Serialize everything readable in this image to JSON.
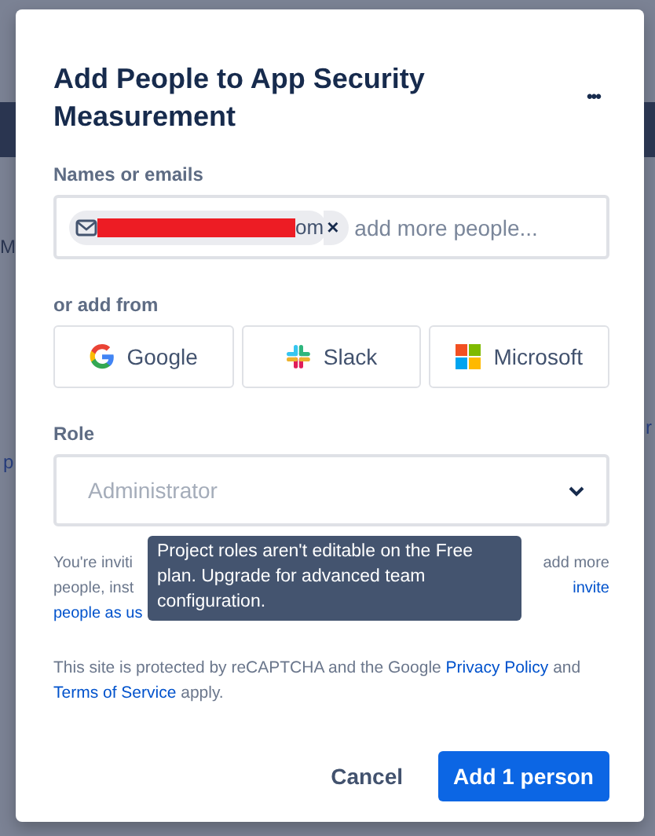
{
  "backdrop_left": [
    "M",
    "p"
  ],
  "backdrop_right": [
    "r"
  ],
  "dialog": {
    "title": "Add People to App Security Measurement",
    "menu": "•••"
  },
  "names": {
    "label": "Names or emails",
    "chip": {
      "visible_text": "om",
      "redacted": true,
      "remove": "×"
    },
    "placeholder": "add more people..."
  },
  "sources": {
    "label": "or add from",
    "buttons": [
      {
        "kind": "google",
        "label": "Google"
      },
      {
        "kind": "slack",
        "label": "Slack"
      },
      {
        "kind": "microsoft",
        "label": "Microsoft"
      }
    ]
  },
  "role": {
    "label": "Role",
    "value": "Administrator",
    "disabled": true
  },
  "notice": {
    "line_1_start": "You're inviti",
    "line_1_end": "add more",
    "line_2_start": "people, inst",
    "line_2_link": "invite",
    "line_3_link": "people as us"
  },
  "tooltip": "Project roles aren't editable on the Free plan. Upgrade for advanced team configuration.",
  "legal": {
    "before": "This site is protected by reCAPTCHA and the Google",
    "link_1": "Privacy Policy",
    "middle": "and",
    "link_2": "Terms of Service",
    "after": "apply."
  },
  "actions": {
    "cancel": "Cancel",
    "submit": "Add 1 person"
  }
}
